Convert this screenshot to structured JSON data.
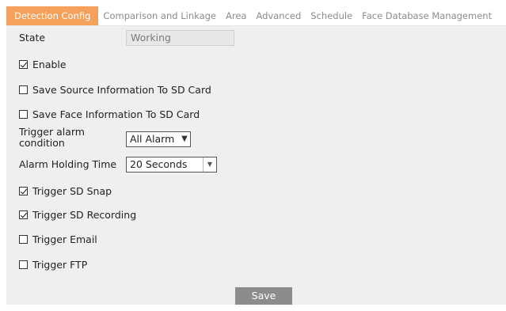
{
  "tabs": [
    {
      "label": "Detection Config",
      "active": true
    },
    {
      "label": "Comparison and Linkage",
      "active": false
    },
    {
      "label": "Area",
      "active": false
    },
    {
      "label": "Advanced",
      "active": false
    },
    {
      "label": "Schedule",
      "active": false
    },
    {
      "label": "Face Database Management",
      "active": false
    }
  ],
  "form": {
    "state_label": "State",
    "state_value": "Working",
    "enable_label": "Enable",
    "enable_checked": true,
    "save_source_label": "Save Source Information To SD Card",
    "save_source_checked": false,
    "save_face_label": "Save Face Information To SD Card",
    "save_face_checked": false,
    "trigger_condition_label_1": "Trigger alarm",
    "trigger_condition_label_2": "condition",
    "trigger_condition_value": "All Alarm",
    "holding_time_label": "Alarm Holding Time",
    "holding_time_value": "20 Seconds",
    "sd_snap_label": "Trigger SD Snap",
    "sd_snap_checked": true,
    "sd_recording_label": "Trigger SD Recording",
    "sd_recording_checked": true,
    "email_label": "Trigger Email",
    "email_checked": false,
    "ftp_label": "Trigger FTP",
    "ftp_checked": false
  },
  "save_label": "Save",
  "colors": {
    "active_tab": "#f5a15c",
    "panel": "#efefef",
    "save_button": "#8c8c8c"
  }
}
